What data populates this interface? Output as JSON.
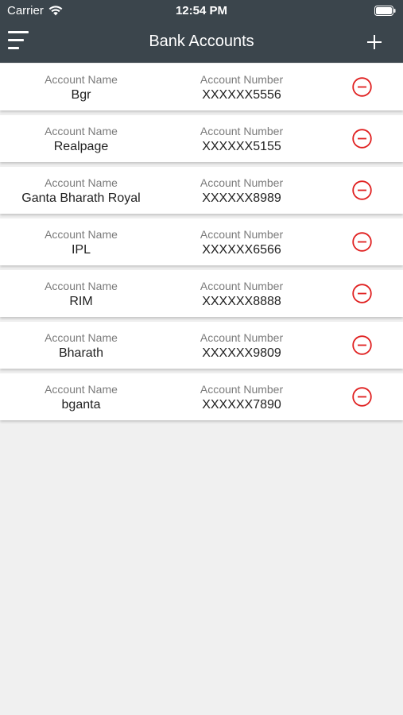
{
  "status_bar": {
    "carrier": "Carrier",
    "time": "12:54 PM"
  },
  "nav": {
    "title": "Bank Accounts",
    "menu_icon": "hamburger-menu-icon",
    "add_icon": "plus-icon"
  },
  "labels": {
    "account_name": "Account Name",
    "account_number": "Account Number"
  },
  "colors": {
    "header_bg": "#3b454c",
    "delete_red": "#e02020",
    "page_bg": "#f0f0f0"
  },
  "accounts": [
    {
      "name": "Bgr",
      "number": "XXXXXX5556"
    },
    {
      "name": "Realpage",
      "number": "XXXXXX5155"
    },
    {
      "name": "Ganta Bharath Royal",
      "number": "XXXXXX8989"
    },
    {
      "name": "IPL",
      "number": "XXXXXX6566"
    },
    {
      "name": "RIM",
      "number": "XXXXXX8888"
    },
    {
      "name": "Bharath",
      "number": "XXXXXX9809"
    },
    {
      "name": "bganta",
      "number": "XXXXXX7890"
    }
  ]
}
